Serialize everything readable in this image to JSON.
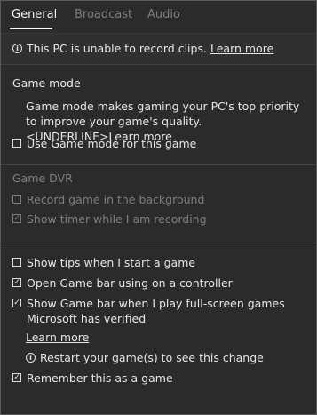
{
  "tabs": {
    "general": "General",
    "broadcast": "Broadcast",
    "audio": "Audio"
  },
  "banner": {
    "text": "This PC is unable to record clips.",
    "link": "Learn more"
  },
  "game_mode": {
    "title": "Game mode",
    "description": "Game mode makes gaming your PC's top priority to improve your game's quality. <UNDERLINE>Learn more",
    "checkbox_label": "Use Game mode for this game",
    "checked": false
  },
  "game_dvr": {
    "title": "Game DVR",
    "record_background": "Record game in the background",
    "record_background_checked": false,
    "show_timer": "Show timer while I am recording",
    "show_timer_checked": true
  },
  "options": {
    "show_tips": "Show tips when I start a game",
    "show_tips_checked": false,
    "open_gamebar": "Open Game bar using  on a controller",
    "open_gamebar_checked": true,
    "show_gamebar_fullscreen": "Show Game bar when I play full-screen games Microsoft has verified",
    "show_gamebar_fullscreen_checked": true,
    "learn_more": "Learn more",
    "restart_notice": "Restart your game(s) to see this change",
    "remember_game": "Remember this as a game",
    "remember_game_checked": true
  },
  "colors": {
    "background": "#2b2b2b",
    "text": "#e6e6e6",
    "dim_text": "#7f7f7f"
  }
}
